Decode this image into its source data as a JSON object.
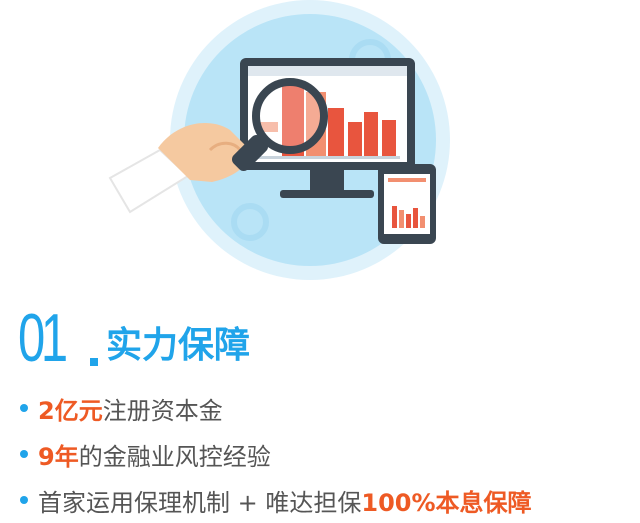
{
  "heading": {
    "number": "01",
    "title": "实力保障"
  },
  "bullets": [
    {
      "highlight": "2亿元",
      "text": "注册资本金"
    },
    {
      "highlight": "9年",
      "text": "的金融业风控经验"
    },
    {
      "text": "首家运用保理机制 + 唯达担保",
      "highlight": "100%本息保障"
    }
  ],
  "colors": {
    "accent": "#20a4ea",
    "highlight": "#ee5a24",
    "text": "#555555"
  },
  "icons": [
    "monitor-icon",
    "magnifier-icon",
    "phone-icon",
    "gear-icon",
    "hand-icon"
  ]
}
